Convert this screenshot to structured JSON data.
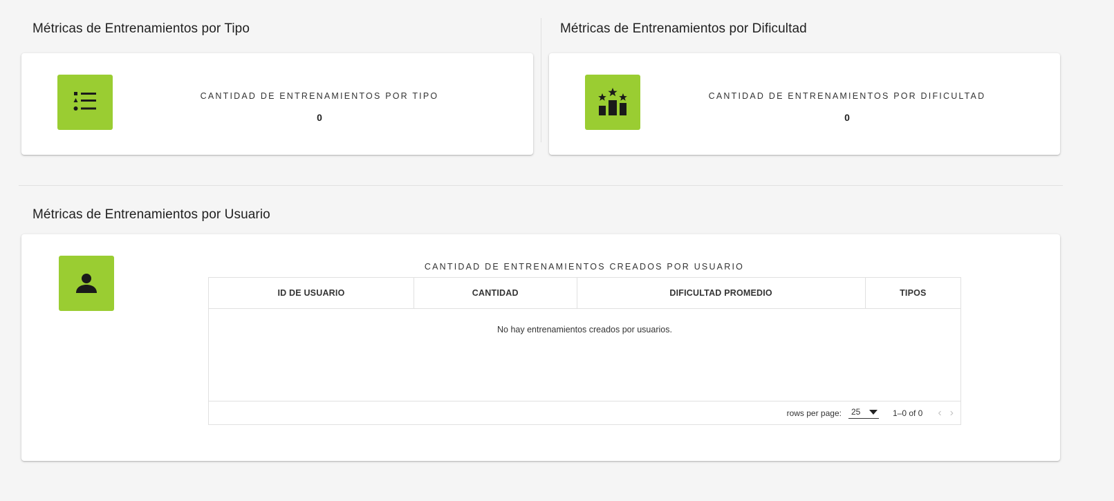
{
  "colors": {
    "accent": "#9acd32",
    "icon_fg": "#1a1a1a",
    "background": "#f5f5f5",
    "card": "#ffffff"
  },
  "tipo": {
    "section_title": "Métricas de Entrenamientos por Tipo",
    "icon": "format-list-shapes-icon",
    "label": "CANTIDAD DE ENTRENAMIENTOS POR TIPO",
    "value": "0"
  },
  "dificultad": {
    "section_title": "Métricas de Entrenamientos por Dificultad",
    "icon": "podium-stars-icon",
    "label": "CANTIDAD DE ENTRENAMIENTOS POR DIFICULTAD",
    "value": "0"
  },
  "usuario": {
    "section_title": "Métricas de Entrenamientos por Usuario",
    "icon": "person-icon",
    "table_caption": "CANTIDAD DE ENTRENAMIENTOS CREADOS POR USUARIO",
    "columns": [
      "ID DE USUARIO",
      "CANTIDAD",
      "DIFICULTAD PROMEDIO",
      "TIPOS"
    ],
    "empty_message": "No hay entrenamientos creados por usuarios.",
    "footer": {
      "rows_per_page_label": "rows per page:",
      "rows_per_page_value": "25",
      "page_range": "1–0 of 0"
    }
  }
}
